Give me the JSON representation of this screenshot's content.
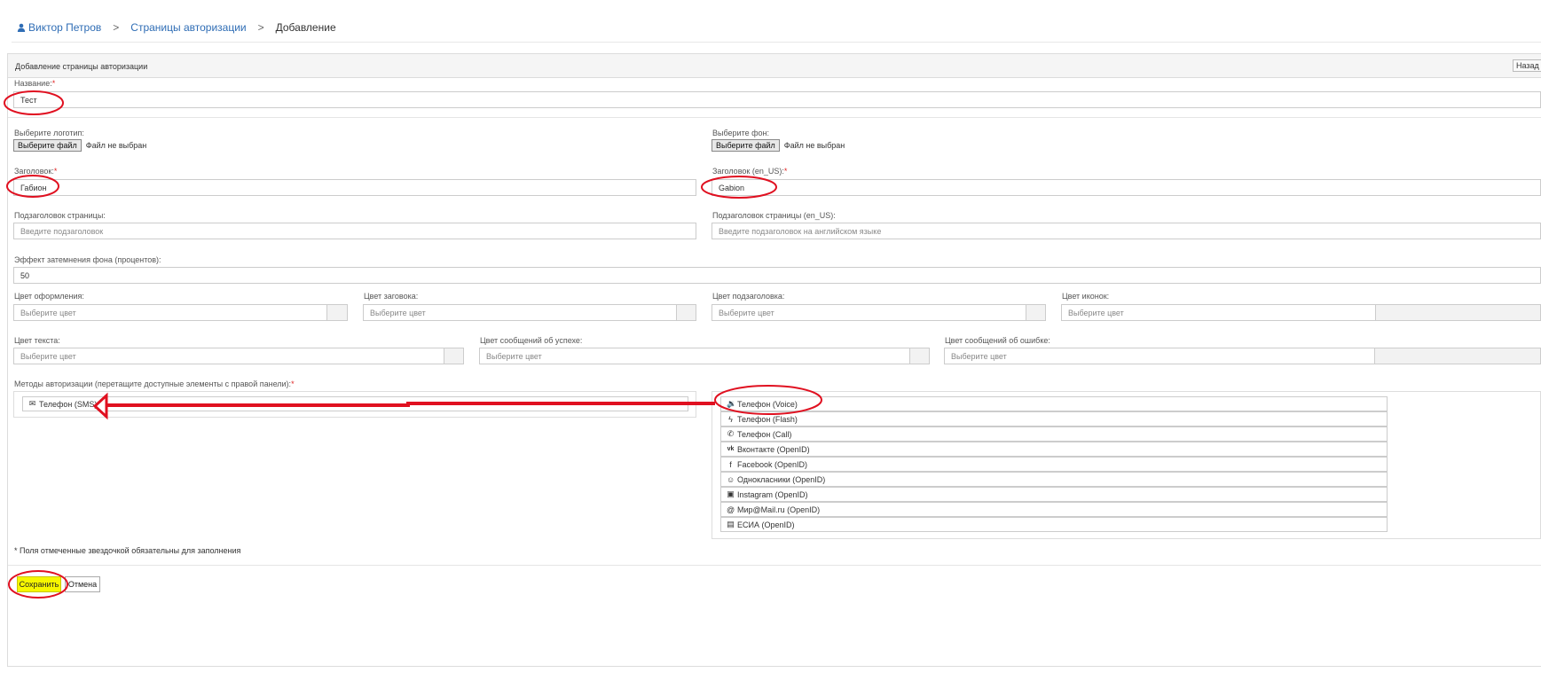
{
  "breadcrumb": {
    "user": "Виктор Петров",
    "section": "Страницы авторизации",
    "current": "Добавление",
    "separator": ">"
  },
  "panel": {
    "title": "Добавление страницы авторизации",
    "back_label": "Назад"
  },
  "form": {
    "name_label": "Название:",
    "name_value": "Тест",
    "logo_label": "Выберите логотип:",
    "bg_label": "Выберите фон:",
    "file_button": "Выберите файл",
    "file_none": "Файл не выбран",
    "header_label": "Заголовок:",
    "header_value": "Габион",
    "header_en_label": "Заголовок (en_US):",
    "header_en_value": "Gabion",
    "subheader_label": "Подзаголовок страницы:",
    "subheader_placeholder": "Введите подзаголовок",
    "subheader_en_label": "Подзаголовок страницы (en_US):",
    "subheader_en_placeholder": "Введите подзаголовок на английском языке",
    "dim_label": "Эффект затемнения фона (процентов):",
    "dim_value": "50",
    "color_placeholder": "Выберите цвет",
    "color_design_label": "Цвет оформления:",
    "color_header_label": "Цвет заговока:",
    "color_subheader_label": "Цвет подзаголовка:",
    "color_icons_label": "Цвет иконок:",
    "color_text_label": "Цвет текста:",
    "color_success_label": "Цвет сообщений об успехе:",
    "color_error_label": "Цвет сообщений об ошибке:",
    "methods_label": "Методы авторизации (перетащите доступные элементы с правой панели):",
    "required_mark": "*"
  },
  "selected_methods": [
    {
      "label": "Телефон (SMS)",
      "icon": "envelope-icon"
    }
  ],
  "available_methods": [
    {
      "label": "Телефон (Voice)",
      "icon": "volume-icon"
    },
    {
      "label": "Телефон (Flash)",
      "icon": "bolt-icon"
    },
    {
      "label": "Телефон (Call)",
      "icon": "phone-icon"
    },
    {
      "label": "Вконтакте (OpenID)",
      "icon": "vk-icon"
    },
    {
      "label": "Facebook (OpenID)",
      "icon": "facebook-icon"
    },
    {
      "label": "Однокласники (OpenID)",
      "icon": "odnoklassniki-icon"
    },
    {
      "label": "Instagram (OpenID)",
      "icon": "instagram-icon"
    },
    {
      "label": "Мир@Mail.ru (OpenID)",
      "icon": "at-sign-icon"
    },
    {
      "label": "ЕСИА (OpenID)",
      "icon": "id-card-icon"
    }
  ],
  "footer": {
    "note": "* Поля отмеченные звездочкой обязательны для заполнения",
    "save_label": "Сохранить",
    "cancel_label": "Отмена"
  },
  "colors": {
    "link": "#2f6db5",
    "required": "#e02828",
    "annotation": "#e01020",
    "save_button": "#f7f700"
  }
}
